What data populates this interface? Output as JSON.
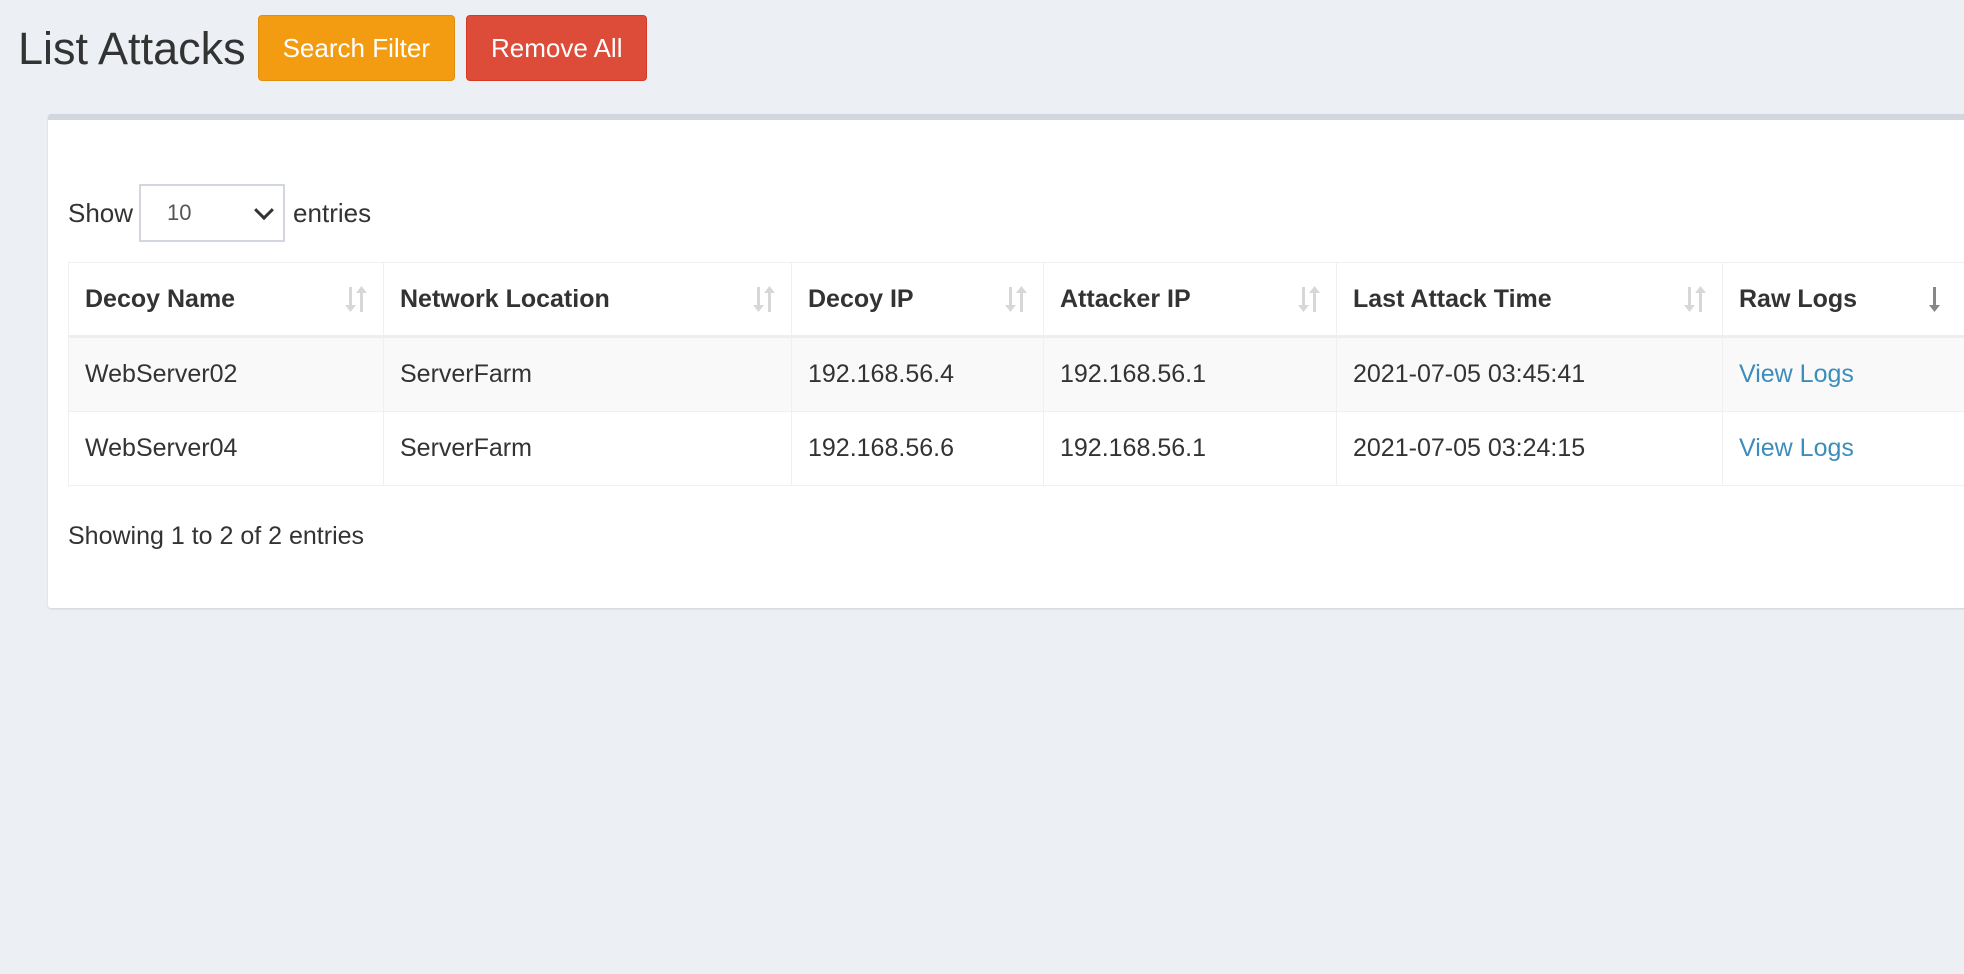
{
  "header": {
    "title": "List Attacks",
    "search_filter_label": "Search Filter",
    "remove_all_label": "Remove All",
    "colors": {
      "search_filter": "#f39c12",
      "remove_all": "#dd4b39"
    }
  },
  "table_controls": {
    "show_label": "Show",
    "page_length": "10",
    "entries_label": "entries"
  },
  "table": {
    "columns": [
      {
        "label": "Decoy Name",
        "sort_icon": "sort-both-icon"
      },
      {
        "label": "Network Location",
        "sort_icon": "sort-both-icon"
      },
      {
        "label": "Decoy IP",
        "sort_icon": "sort-both-icon"
      },
      {
        "label": "Attacker IP",
        "sort_icon": "sort-both-icon"
      },
      {
        "label": "Last Attack Time",
        "sort_icon": "sort-both-icon"
      },
      {
        "label": "Raw Logs",
        "sort_icon": "sort-desc-icon"
      }
    ],
    "rows": [
      {
        "decoy_name": "WebServer02",
        "network_location": "ServerFarm",
        "decoy_ip": "192.168.56.4",
        "attacker_ip": "192.168.56.1",
        "last_attack_time": "2021-07-05 03:45:41",
        "raw_logs": "View Logs"
      },
      {
        "decoy_name": "WebServer04",
        "network_location": "ServerFarm",
        "decoy_ip": "192.168.56.6",
        "attacker_ip": "192.168.56.1",
        "last_attack_time": "2021-07-05 03:24:15",
        "raw_logs": "View Logs"
      }
    ],
    "link_color": "#3c8dbc"
  },
  "info_text": "Showing 1 to 2 of 2 entries"
}
